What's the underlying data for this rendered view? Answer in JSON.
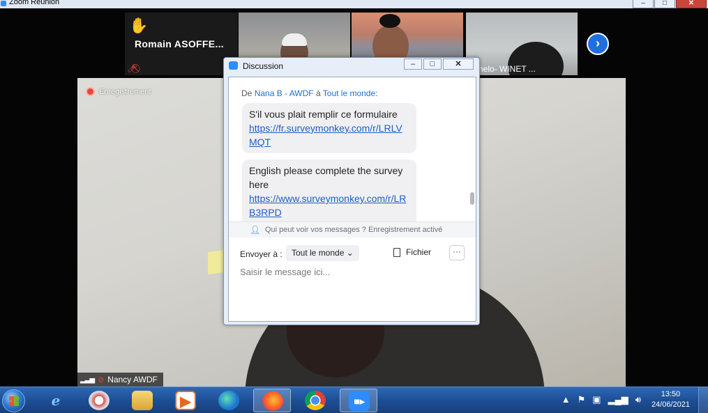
{
  "window": {
    "title": "Zoom Réunion",
    "minimize": "‒",
    "maximize": "□",
    "close": "✕"
  },
  "participants_strip": {
    "raised_hand_icon": "raised-hand-icon",
    "featured_name": "Romain  ASOFFE...",
    "tile_label_3": "nelo- WINET ...",
    "next_icon": "chevron-right-icon"
  },
  "main_video": {
    "recording_label": "Enregistrement",
    "speaker_name": "Nancy AWDF"
  },
  "chat": {
    "title": "Discussion",
    "minimize": "‒",
    "maximize": "□",
    "close": "✕",
    "from_prefix": "De",
    "from_name": "Nana B - AWDF",
    "from_mid": "à",
    "to_name": "Tout le monde",
    "from_suffix": ":",
    "messages": [
      {
        "text": "S'il vous plait remplir ce formulaire",
        "link": "https://fr.surveymonkey.com/r/LRLVMQT"
      },
      {
        "text": "English please complete the survey here",
        "link": "https://www.surveymonkey.com/r/LRB3RPD"
      }
    ],
    "privacy_notice": "Qui peut voir vos messages ? Enregistrement activé",
    "send_to_label": "Envoyer à :",
    "recipient": "Tout le monde",
    "file_label": "Fichier",
    "more_label": "···",
    "input_placeholder": "Saisir le message ici..."
  },
  "taskbar": {
    "items": [
      "ie-icon",
      "paint-icon",
      "explorer-icon",
      "media-player-icon",
      "edge-icon",
      "firefox-icon",
      "chrome-icon",
      "zoom-icon"
    ],
    "tray_icons": [
      "show-hidden-icon",
      "flag-icon",
      "device-icon",
      "signal-icon",
      "volume-icon"
    ],
    "time": "13:50",
    "date": "24/06/2021"
  },
  "colors": {
    "zoom_blue": "#2d8cff",
    "link_blue": "#1b5fc4",
    "recording_red": "#e8473b",
    "taskbar": "#1d4f96"
  }
}
